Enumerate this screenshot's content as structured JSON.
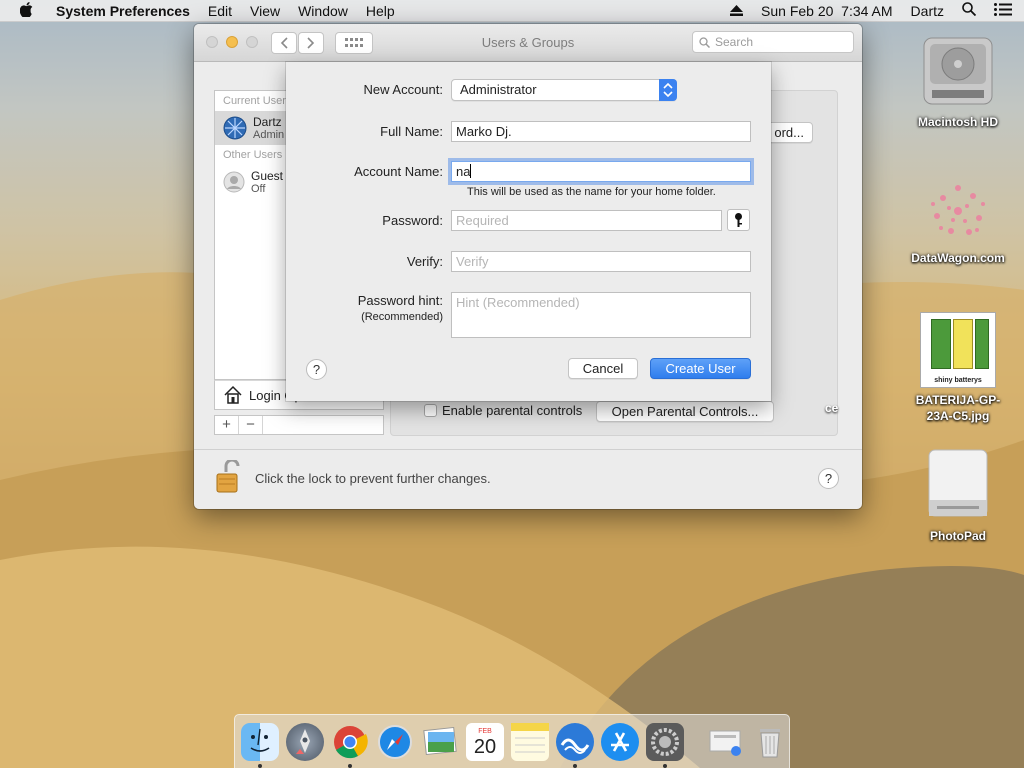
{
  "menubar": {
    "app": "System Preferences",
    "items": [
      "Edit",
      "View",
      "Window",
      "Help"
    ],
    "clock": "Sun Feb 20  7:34 AM",
    "user": "Dartz"
  },
  "desktop": {
    "icons": [
      {
        "label": "Macintosh HD"
      },
      {
        "label": "DataWagon.com"
      },
      {
        "label": "BATERIJA-GP-23A-C5.jpg"
      },
      {
        "label": "PhotoPad"
      }
    ],
    "thumb_text": "shiny batterys"
  },
  "window": {
    "title": "Users & Groups",
    "search_placeholder": "Search",
    "sections": {
      "current": "Current Users",
      "other": "Other Users"
    },
    "users": [
      {
        "name": "Dartz",
        "role": "Admin"
      },
      {
        "name": "Guest",
        "role": "Off"
      }
    ],
    "login_options": "Login Options",
    "plus": "+",
    "minus": "−",
    "password_btn": "ord...",
    "partial_label": "ce",
    "parental_checkbox": "Enable parental controls",
    "parental_btn": "Open Parental Controls...",
    "lock_text": "Click the lock to prevent further changes.",
    "help": "?"
  },
  "sheet": {
    "new_account_label": "New Account:",
    "new_account_value": "Administrator",
    "full_name_label": "Full Name:",
    "full_name_value": "Marko Dj.",
    "account_name_label": "Account Name:",
    "account_name_value": "na",
    "account_name_hint": "This will be used as the name for your home folder.",
    "password_label": "Password:",
    "password_placeholder": "Required",
    "verify_label": "Verify:",
    "verify_placeholder": "Verify",
    "hint_label": "Password hint:",
    "hint_sub": "(Recommended)",
    "hint_placeholder": "Hint (Recommended)",
    "help": "?",
    "cancel": "Cancel",
    "create": "Create User"
  },
  "dock": {
    "calendar_month": "FEB",
    "calendar_day": "20"
  },
  "colors": {
    "accent": "#3b82f0",
    "focus": "#79a9ee"
  }
}
